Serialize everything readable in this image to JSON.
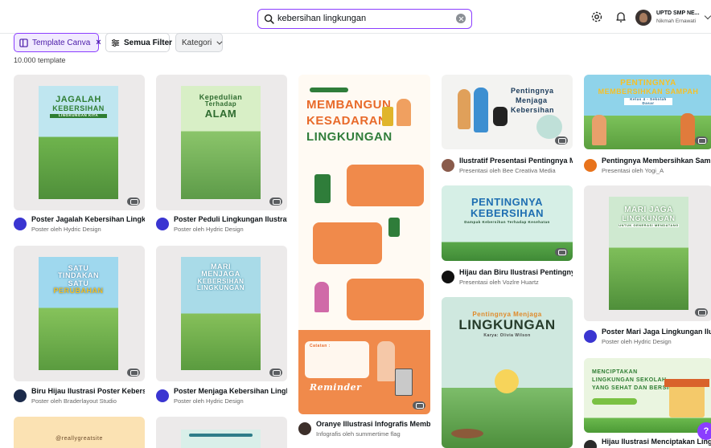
{
  "search": {
    "query": "kebersihan lingkungan"
  },
  "user": {
    "name": "UPTD SMP NE...",
    "sub": "Nikmah Ernawati"
  },
  "filters": {
    "active_chip": "Template Canva",
    "active_close": "×",
    "all_filters": "Semua Filter",
    "category": "Kategori"
  },
  "result_count": "10.000 template",
  "help_label": "?",
  "cards": [
    {
      "title": "Poster Jagalah Kebersihan Lingku...",
      "sub": "Poster oleh Hydric Design",
      "art": [
        "JAGALAH",
        "KEBERSIHAN",
        "LINGKUNGAN KITA"
      ]
    },
    {
      "title": "Poster Peduli Lingkungan Ilustratif...",
      "sub": "Poster oleh Hydric Design",
      "art": [
        "Kepedulian",
        "Terhadap",
        "ALAM"
      ]
    },
    {
      "title": "Oranye Illustrasi Infografis Memba...",
      "sub": "Infografis oleh summertime flag",
      "art": [
        "MEMBANGUN",
        "KESADARAN",
        "LINGKUNGAN",
        "Reminder",
        "Catatan :"
      ]
    },
    {
      "title": "Ilustratif Presentasi Pentingnya M...",
      "sub": "Presentasi oleh Bee Creativa Media",
      "art": [
        "Pentingnya",
        "Menjaga",
        "Kebersihan"
      ]
    },
    {
      "title": "Pentingnya Membersihkan Sampa...",
      "sub": "Presentasi oleh Yogi_A",
      "art": [
        "PENTINGNYA",
        "MEMBERSIHKAN SAMPAH",
        "Kelas 4 - Sekolah Dasar"
      ]
    },
    {
      "title": "Biru Hijau Ilustrasi Poster Kebersi...",
      "sub": "Poster oleh Braderlayout Studio",
      "art": [
        "SATU",
        "TINDAKAN",
        "SATU",
        "PERUBAHAN"
      ]
    },
    {
      "title": "Poster Menjaga Kebersihan Lingku...",
      "sub": "Poster oleh Hydric Design",
      "art": [
        "MARI",
        "MENJAGA",
        "KEBERSIHAN",
        "LINGKUNGAN"
      ]
    },
    {
      "title": "Hijau dan Biru Ilustrasi Pentingnya...",
      "sub": "Presentasi oleh Vozlre Huartz",
      "art": [
        "PENTINGNYA",
        "KEBERSIHAN",
        "Dampak Kebersihan Terhadap Kesehatan"
      ]
    },
    {
      "title": "Poster Mari Jaga Lingkungan Ilustr...",
      "sub": "Poster oleh Hydric Design",
      "art": [
        "MARI JAGA",
        "LINGKUNGAN",
        "UNTUK GENERASI MENDATANG"
      ]
    },
    {
      "title": "",
      "sub": "",
      "art": [
        "Pentingnya Menjaga",
        "LINGKUNGAN",
        "Karya: Olivia Wilson"
      ]
    },
    {
      "title": "Hijau Ilustrasi Menciptakan Lingk...",
      "sub": "",
      "art": [
        "MENCIPTAKAN",
        "LINGKUNGAN SEKOLAH",
        "YANG SEHAT DAN BERSIH"
      ]
    },
    {
      "title": "",
      "sub": "",
      "art": [
        "@reallygreatsite"
      ]
    }
  ],
  "colors": {
    "accent": "#8b3dff",
    "accent_bg": "#f1eaff"
  }
}
